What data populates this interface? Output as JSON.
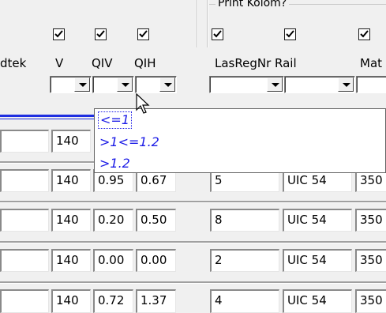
{
  "group": {
    "title": "Print Kolom?"
  },
  "columns": [
    {
      "key": "dtek",
      "label": "dtek"
    },
    {
      "key": "v",
      "label": "V"
    },
    {
      "key": "qiv",
      "label": "QIV"
    },
    {
      "key": "qih",
      "label": "QIH"
    },
    {
      "key": "lasregnr",
      "label": "LasRegNr"
    },
    {
      "key": "rail",
      "label": "Rail"
    },
    {
      "key": "mat",
      "label": "Mat"
    }
  ],
  "checkboxes": {
    "v": true,
    "qiv": true,
    "qih": true,
    "lasregnr": true,
    "rail": true,
    "mat": true
  },
  "dropdown": {
    "items": [
      "<=1",
      ">1<=1.2",
      ">1.2"
    ],
    "selected_index": 0
  },
  "rows": [
    {
      "v": "140",
      "qiv": "",
      "qih": "",
      "lasregnr": "",
      "rail": "",
      "mat": ""
    },
    {
      "v": "140",
      "qiv": "0.95",
      "qih": "0.67",
      "lasregnr": "5",
      "rail": "UIC 54",
      "mat": "350"
    },
    {
      "v": "140",
      "qiv": "0.20",
      "qih": "0.50",
      "lasregnr": "8",
      "rail": "UIC 54",
      "mat": "350"
    },
    {
      "v": "140",
      "qiv": "0.00",
      "qih": "0.00",
      "lasregnr": "2",
      "rail": "UIC 54",
      "mat": "350"
    },
    {
      "v": "140",
      "qiv": "0.72",
      "qih": "1.37",
      "lasregnr": "4",
      "rail": "UIC 54",
      "mat": "350"
    }
  ]
}
